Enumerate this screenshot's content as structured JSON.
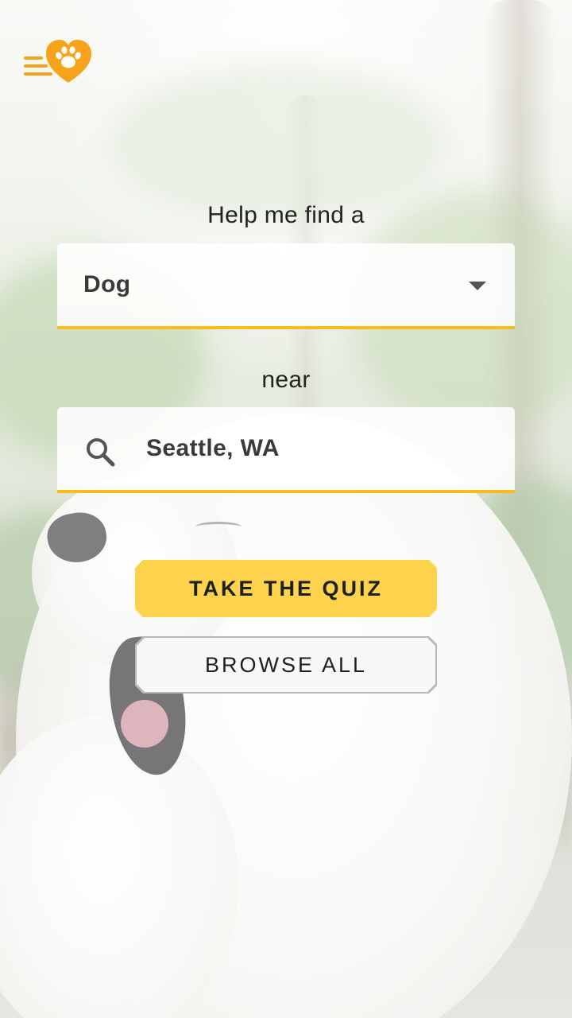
{
  "header": {
    "menu_icon": "menu-lines-icon",
    "logo_icon": "heart-paw-icon",
    "brand_color": "#f7a21b"
  },
  "search": {
    "prompt_label": "Help me find a",
    "pet_type": {
      "selected": "Dog",
      "icon": "caret-down-icon"
    },
    "near_label": "near",
    "location": {
      "value": "Seattle, WA",
      "icon": "search-icon"
    },
    "underline_color": "#f7bd1f"
  },
  "actions": {
    "quiz_label": "TAKE THE QUIZ",
    "quiz_color": "#fdd24c",
    "browse_label": "BROWSE ALL"
  }
}
